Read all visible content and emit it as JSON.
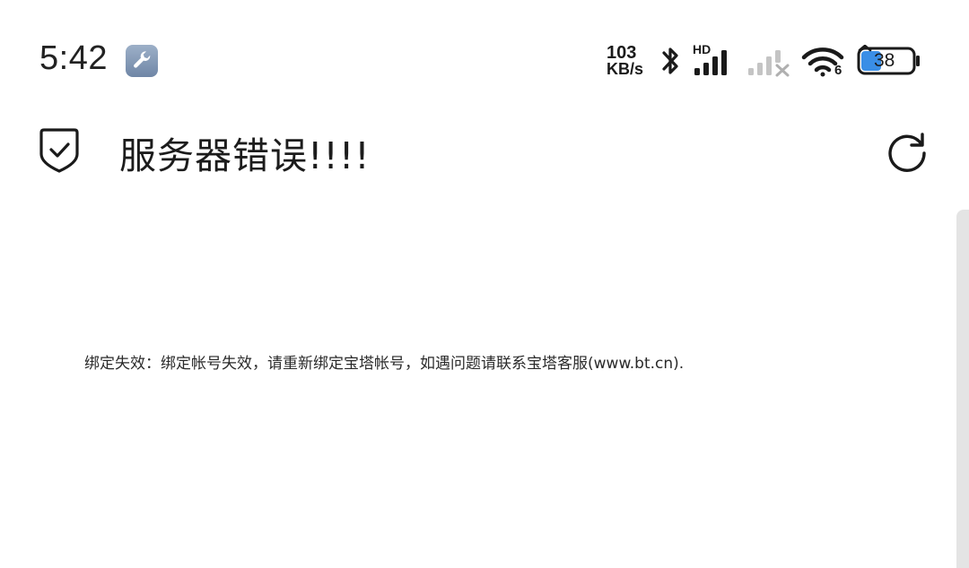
{
  "status_bar": {
    "time": "5:42",
    "net_speed_value": "103",
    "net_speed_unit": "KB/s",
    "signal_label": "HD",
    "wifi_label": "6",
    "battery_level": "38",
    "icons": [
      "wrench-icon",
      "bluetooth-icon",
      "signal-icon",
      "signal-off-icon",
      "wifi-icon",
      "battery-icon"
    ]
  },
  "header": {
    "title": "服务器错误!!!!",
    "icons": [
      "shield-check-icon",
      "refresh-icon"
    ]
  },
  "main": {
    "message": "绑定失效：绑定帐号失效，请重新绑定宝塔帐号，如遇问题请联系宝塔客服(www.bt.cn)."
  },
  "colors": {
    "background": "#ffffff",
    "text": "#1f1f1f",
    "battery_accent": "#3a8ee6",
    "scrollbar": "#e4e4e4"
  }
}
